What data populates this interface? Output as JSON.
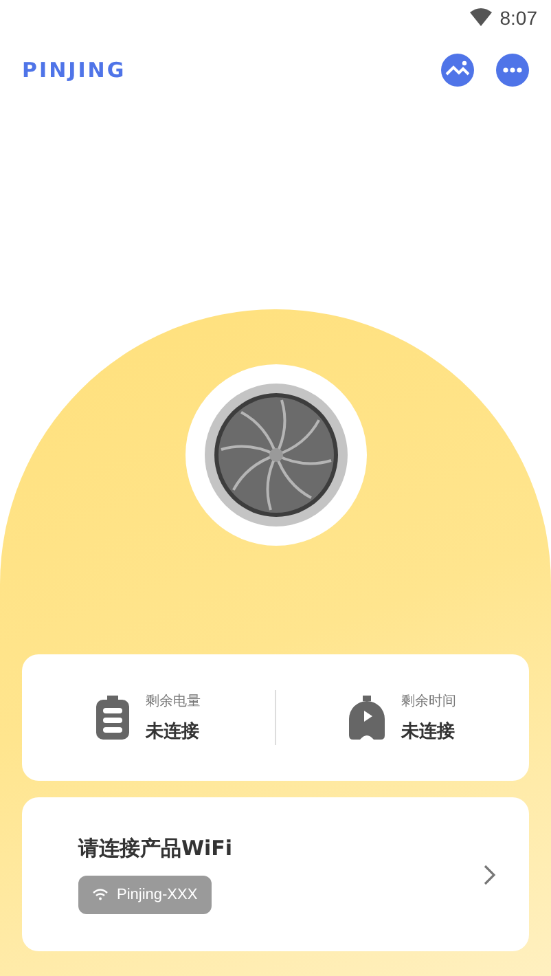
{
  "status_bar": {
    "time": "8:07"
  },
  "header": {
    "logo": "PINJING"
  },
  "stats": [
    {
      "kind": "battery",
      "label": "剩余电量",
      "value": "未连接"
    },
    {
      "kind": "timer",
      "label": "剩余时间",
      "value": "未连接"
    }
  ],
  "wifi_card": {
    "title": "请连接产品WiFi",
    "network": "Pinjing-XXX"
  }
}
